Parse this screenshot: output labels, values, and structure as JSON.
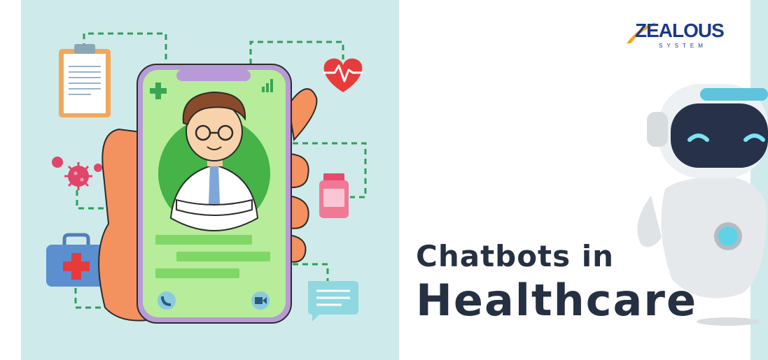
{
  "brand": {
    "logo_word": "ZEALOUS",
    "logo_subtitle": "SYSTEM"
  },
  "headline": {
    "line1": "Chatbots in",
    "line2": "Healthcare"
  },
  "colors": {
    "panel_bg": "#cfeaea",
    "headline_text": "#253042",
    "logo_blue": "#1b3a8c",
    "logo_accent": "#f2a41b",
    "phone_screen": "#b6ec9a",
    "dashed_connector": "#2f9e5a"
  },
  "icons": [
    "clipboard-icon",
    "heart-rate-icon",
    "virus-icon",
    "medicine-bottle-icon",
    "first-aid-kit-icon",
    "chat-bubble-icon",
    "phone-call-icon",
    "video-call-icon",
    "signal-icon",
    "plus-icon",
    "robot-icon"
  ]
}
